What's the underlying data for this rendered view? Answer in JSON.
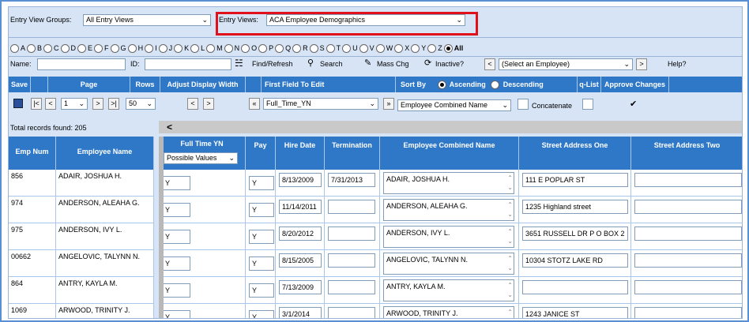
{
  "top": {
    "groups_label": "Entry View Groups:",
    "groups_value": "All Entry Views",
    "views_label": "Entry Views:",
    "views_value": "ACA Employee Demographics"
  },
  "letters": [
    "A",
    "B",
    "C",
    "D",
    "E",
    "F",
    "G",
    "H",
    "I",
    "J",
    "K",
    "L",
    "M",
    "N",
    "O",
    "P",
    "Q",
    "R",
    "S",
    "T",
    "U",
    "V",
    "W",
    "X",
    "Y",
    "Z",
    "All"
  ],
  "searchbar": {
    "name_label": "Name:",
    "id_label": "ID:",
    "find_label": "Find/Refresh",
    "search_label": "Search",
    "masschg_label": "Mass Chg",
    "inactive_label": "Inactive?",
    "employee_select": "(Select an Employee)",
    "help_label": "Help?"
  },
  "header": {
    "save": "Save",
    "page": "Page",
    "rows": "Rows",
    "adjust": "Adjust Display Width",
    "first_field": "First Field To Edit",
    "sort_by": "Sort By",
    "ascending": "Ascending",
    "descending": "Descending",
    "qlist": "q-List",
    "approve": "Approve Changes"
  },
  "controls": {
    "page_value": "1",
    "rows_value": "50",
    "first_field_value": "Full_Time_YN",
    "sort_value": "Employee Combined Name",
    "concatenate": "Concatenate"
  },
  "total_records": "Total records found: 205",
  "columns": {
    "emp_num": "Emp Num",
    "emp_name": "Employee Name",
    "full_time": "Full Time YN",
    "full_time_filter": "Possible Values",
    "pay": "Pay",
    "hire": "Hire Date",
    "term": "Termination",
    "combined": "Employee Combined Name",
    "street1": "Street Address One",
    "street2": "Street Address Two"
  },
  "rows": [
    {
      "num": "856",
      "name": "ADAIR, JOSHUA H.",
      "ft": "Y",
      "pay": "Y",
      "hire": "8/13/2009",
      "term": "7/31/2013",
      "combined": "ADAIR, JOSHUA H.",
      "street1": "111 E POPLAR ST",
      "street2": ""
    },
    {
      "num": "974",
      "name": "ANDERSON, ALEAHA G.",
      "ft": "Y",
      "pay": "Y",
      "hire": "11/14/2011",
      "term": "",
      "combined": "ANDERSON, ALEAHA G.",
      "street1": "1235 Highland street",
      "street2": ""
    },
    {
      "num": "975",
      "name": "ANDERSON, IVY L.",
      "ft": "Y",
      "pay": "Y",
      "hire": "8/20/2012",
      "term": "",
      "combined": "ANDERSON, IVY L.",
      "street1": "3651 RUSSELL DR P O BOX 2",
      "street2": ""
    },
    {
      "num": "00662",
      "name": "ANGELOVIC, TALYNN N.",
      "ft": "Y",
      "pay": "Y",
      "hire": "8/15/2005",
      "term": "",
      "combined": "ANGELOVIC, TALYNN N.",
      "street1": "10304 STOTZ LAKE RD",
      "street2": ""
    },
    {
      "num": "864",
      "name": "ANTRY, KAYLA M.",
      "ft": "Y",
      "pay": "Y",
      "hire": "7/13/2009",
      "term": "",
      "combined": "ANTRY, KAYLA M.",
      "street1": "",
      "street2": ""
    },
    {
      "num": "1069",
      "name": "ARWOOD, TRINITY J.",
      "ft": "Y",
      "pay": "Y",
      "hire": "3/1/2014",
      "term": "",
      "combined": "ARWOOD, TRINITY J.",
      "street1": "1243 JANICE ST",
      "street2": ""
    }
  ],
  "colors": {
    "header_blue": "#2f78c8",
    "panel_bg": "#d6e4f5",
    "highlight_red": "#e0111b"
  }
}
